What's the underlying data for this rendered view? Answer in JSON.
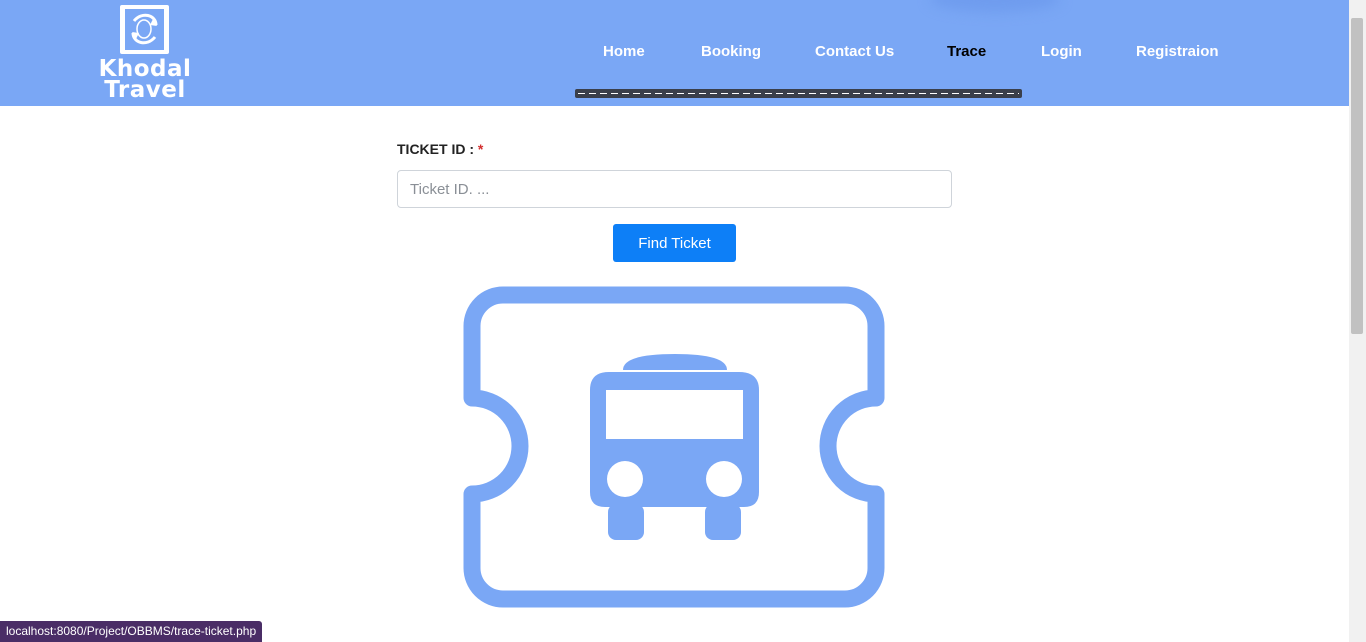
{
  "colors": {
    "brand": "#7aa7f5",
    "primary_button": "#0d7ff7",
    "active_nav": "#000000",
    "required_marker": "#d32f2f"
  },
  "logo": {
    "line1": "Khodal",
    "line2": "Travel",
    "icon": "globe-arrows-icon"
  },
  "nav": {
    "items": [
      {
        "label": "Home",
        "active": false
      },
      {
        "label": "Booking",
        "active": false
      },
      {
        "label": "Contact Us",
        "active": false
      },
      {
        "label": "Trace",
        "active": true
      },
      {
        "label": "Login",
        "active": false
      },
      {
        "label": "Registraion",
        "active": false
      }
    ]
  },
  "form": {
    "label": "TICKET ID :",
    "required_mark": "*",
    "placeholder": "Ticket ID. ...",
    "value": "",
    "button_label": "Find Ticket"
  },
  "illustration": {
    "icon": "bus-ticket-icon"
  },
  "status_bar": {
    "url": "localhost:8080/Project/OBBMS/trace-ticket.php"
  }
}
